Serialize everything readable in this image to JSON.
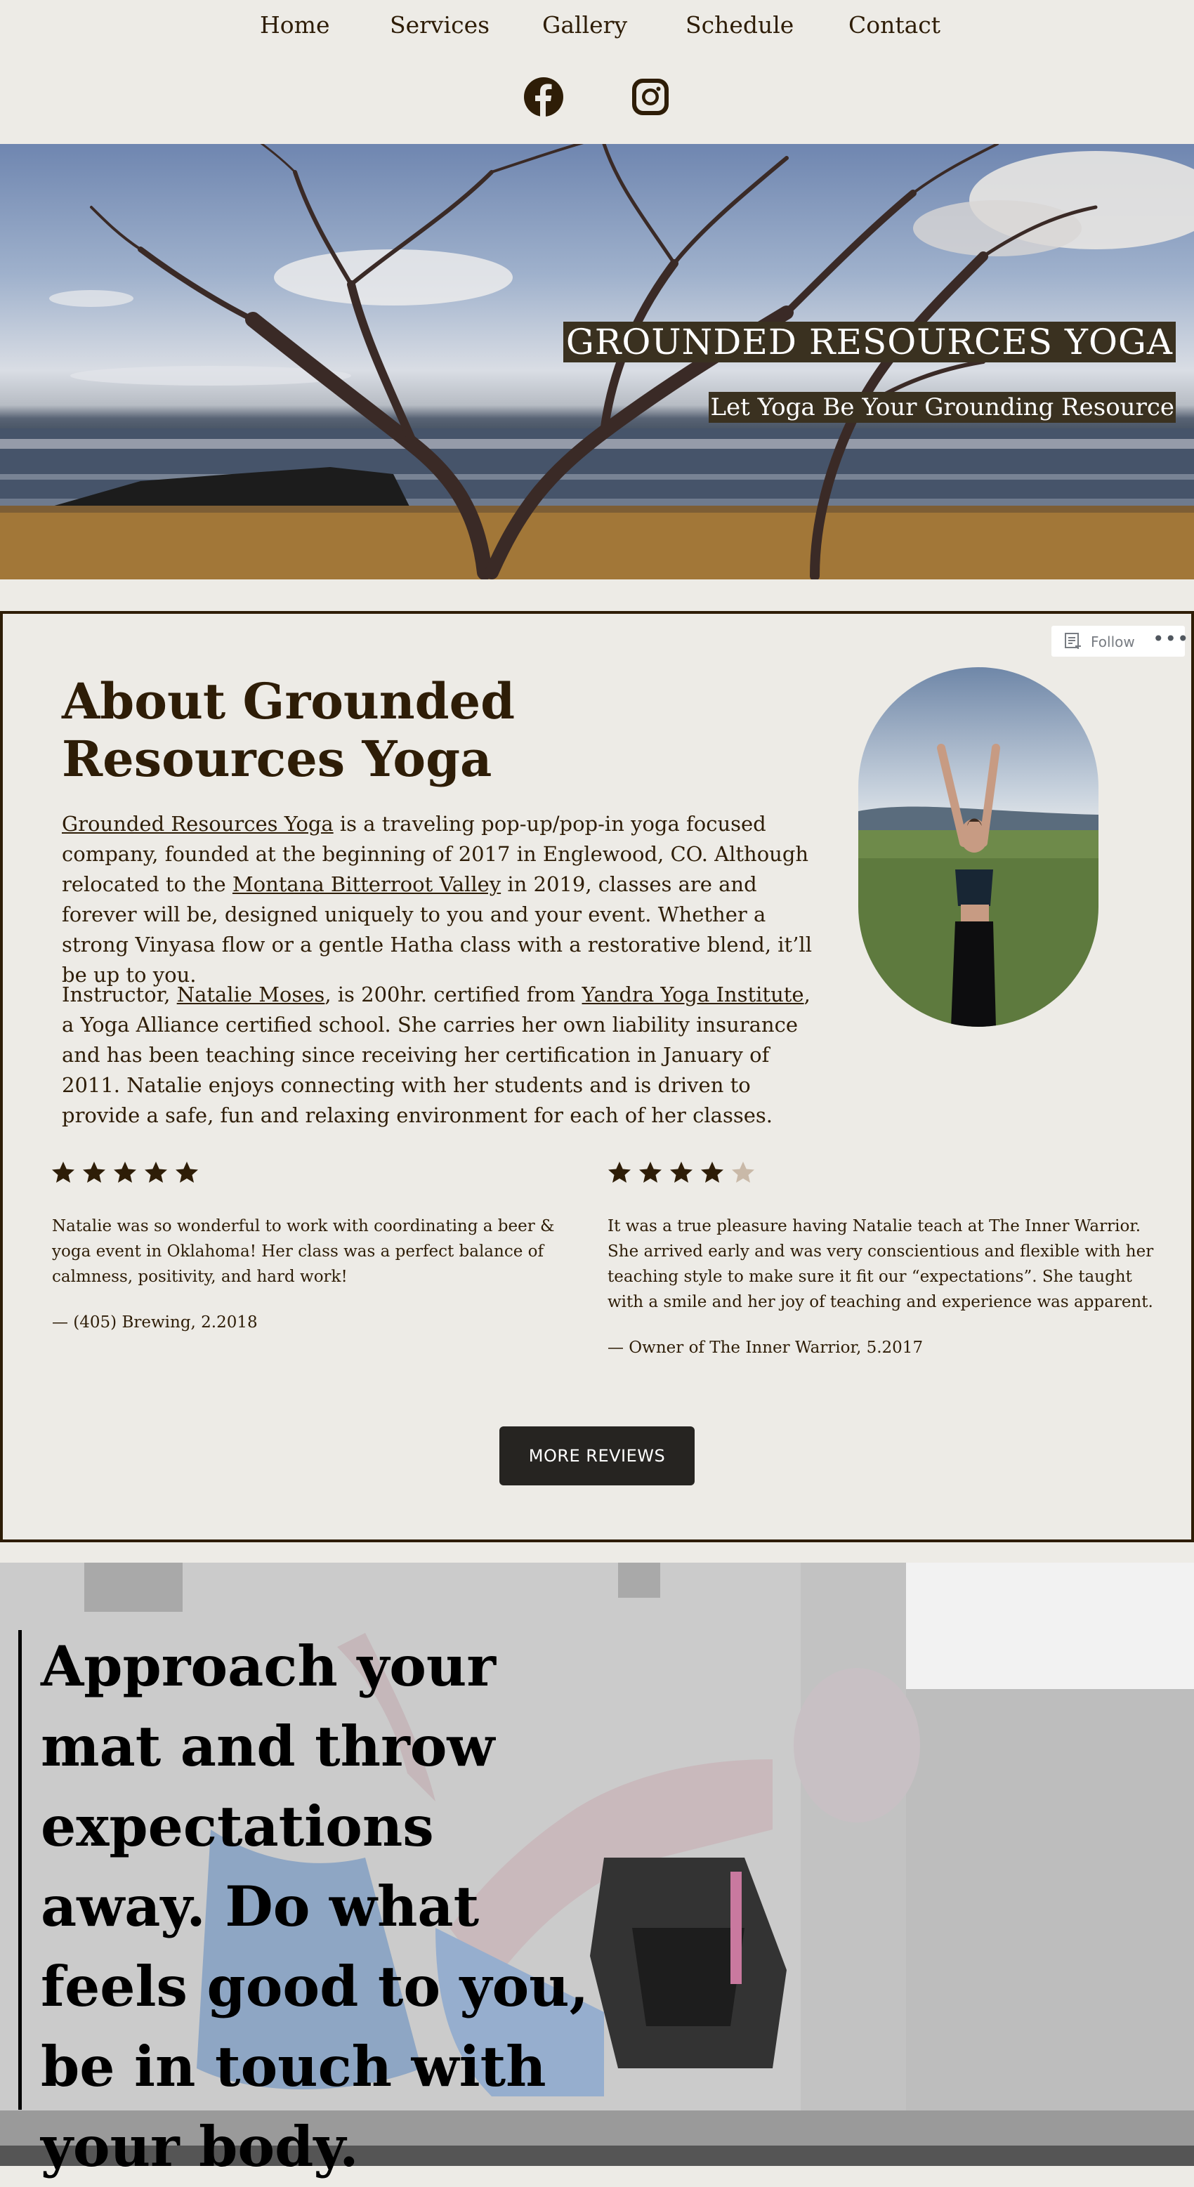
{
  "nav": {
    "items": [
      "Home",
      "Services",
      "Gallery",
      "Schedule",
      "Contact"
    ]
  },
  "social": {
    "icons": [
      "facebook-icon",
      "instagram-icon"
    ]
  },
  "hero": {
    "title": "GROUNDED RESOURCES YOGA",
    "subtitle": "Let Yoga Be Your Grounding Resource"
  },
  "follow": {
    "label": "Follow",
    "more": "•••"
  },
  "about": {
    "title": "About Grounded Resources Yoga",
    "p1_link1": "Grounded Resources Yoga",
    "p1_text1": " is a traveling pop-up/pop-in yoga focused company, founded at the beginning of 2017 in Englewood, CO. Although relocated to the ",
    "p1_link2": "Montana Bitterroot Valley",
    "p1_text2": " in 2019, classes are and forever will be, designed uniquely to you and your event. Whether a strong Vinyasa flow or a gentle Hatha class with a restorative blend, it’ll be up to you.",
    "p2_text1": "Instructor, ",
    "p2_link1": "Natalie Moses",
    "p2_text2": ", is 200hr. certified from ",
    "p2_link2": "Yandra Yoga Institute",
    "p2_text3": ", a Yoga Alliance certified school. She carries her own liability insurance and has been teaching since receiving her certification in January of 2011. Natalie enjoys connecting with her students and is driven to provide a safe, fun and relaxing environment for each of her classes."
  },
  "reviews": [
    {
      "rating": 5,
      "text": "Natalie was so wonderful to work with coordinating a beer & yoga event in Oklahoma! Her class was a perfect balance of calmness, positivity, and hard work!",
      "source": "— (405) Brewing, 2.2018"
    },
    {
      "rating": 4.5,
      "text": "It was a true pleasure having Natalie teach at The Inner Warrior. She arrived early and was very conscientious and flexible with her teaching style to make sure it fit our “expectations”. She taught with a smile and her joy of teaching and experience was apparent.",
      "source": "— Owner of The Inner Warrior, 5.2017"
    }
  ],
  "more_reviews_label": "MORE REVIEWS",
  "quote": {
    "text": "Approach your mat and throw expectations away. Do what feels good to you, be in touch with your body."
  },
  "colors": {
    "text": "#2e1d07",
    "background": "#edebe6",
    "button": "#262421",
    "hero_label_bg": "#3a3120"
  }
}
